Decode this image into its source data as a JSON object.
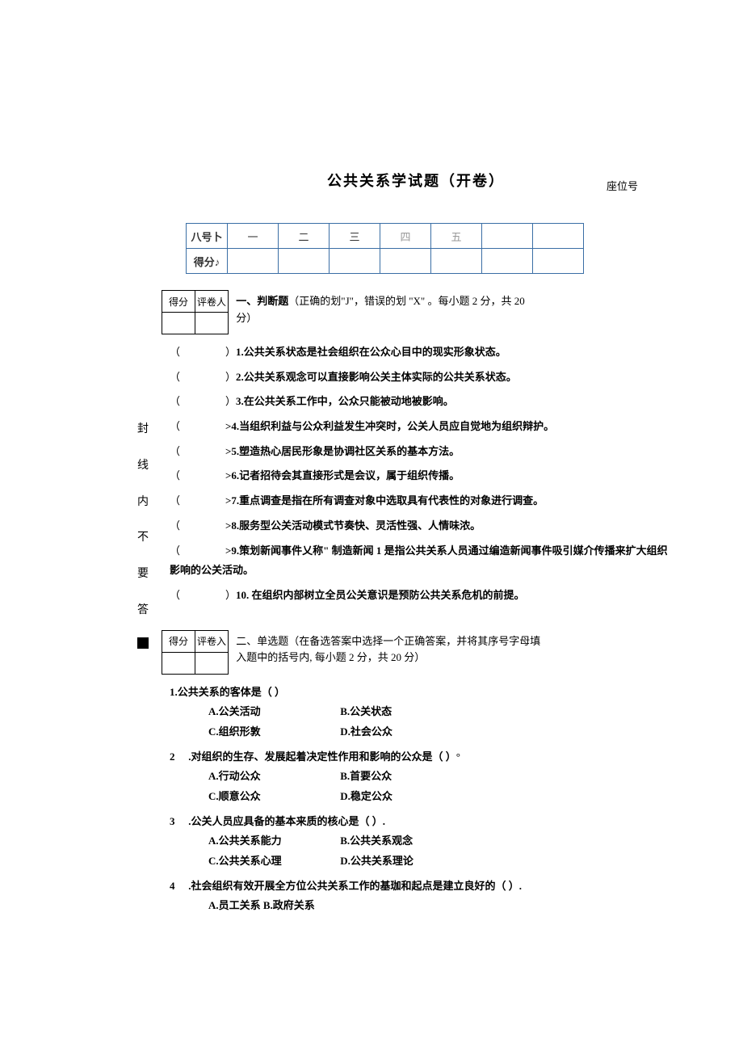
{
  "seat_label": "座位号",
  "title": "公共关系学试题（开卷）",
  "score_table": {
    "row1_head": "八号卜",
    "row2_head": "得分♪",
    "cols": [
      "一",
      "二",
      "三",
      "四",
      "五",
      "",
      ""
    ]
  },
  "grade_box": {
    "c1": "得分",
    "c2": "评卷人"
  },
  "grade_box2": {
    "c1": "得分",
    "c2": "评卷入"
  },
  "section1": {
    "heading": "一、判断题",
    "note": "（正确的划\"J\"，错误的划 \"X\" 。每小题 2 分，共 20 分）",
    "items": {
      "q1": "1.公共关系状态是社会组织在公众心目中的现实形象状态。",
      "q2": "2.公共关系观念可以直接影响公关主体实际的公共关系状态。",
      "q3": "3.在公共关系工作中，公众只能被动地被影响。",
      "q4": ">4.当组织利益与公众利益发生冲突时，公关人员应自觉地为组织辩护。",
      "q5": ">5.塑造热心居民形象是协调社区关系的基本方法。",
      "q6": ">6.记者招待会其直接形式是会议，属于组织传播。",
      "q7": ">7.重点调查是指在所有调查对象中选取具有代表性的对象进行调查。",
      "q8": ">8.服务型公关活动模式节奏快、灵活性强、人情味浓。",
      "q9": ">9.策划新闻事件乂称\" 制造新闻 1 是指公共关系人员通过编造新闻事件吸引媒介传播来扩大组织影响的公关活动。",
      "q10": "10. 在组织内部树立全员公关意识是预防公共关系危机的前提。"
    }
  },
  "side": {
    "s1": "封",
    "s2": "线",
    "s3": "内",
    "s4": "不",
    "s5": "要",
    "s6": "答"
  },
  "section2": {
    "heading": "二、单选题（在备选答案中选择一个正确答案，并将其序号字母填入题中的括号内, 每小题 2 分，共 20 分）",
    "q1": {
      "stem": "1.公共关系的客体是（        ）",
      "a": "A.公关活动",
      "b": "B.公关状态",
      "c": "C.组织形敦",
      "d": "D.社会公众"
    },
    "q2": {
      "num": "2",
      "stem": " .对组织的生存、发展起着决定性作用和影响的公众是（       ）°",
      "a": "A.行动公众",
      "b": "B.首要公众",
      "c": "C.顺意公众",
      "d": "D.稳定公众"
    },
    "q3": {
      "num": "3",
      "stem": " .公关人员应具备的基本来质的核心是（      ）.",
      "a": "A.公共关系能力",
      "b": "B.公共关系观念",
      "c": "C.公共关系心理",
      "d": "D.公共关系理论"
    },
    "q4": {
      "num": "4",
      "stem": " .社会组织有效开展全方位公共关系工作的基珈和起点是建立良好的（        ）.",
      "a": "A.员工关系 B.政府关系"
    }
  },
  "paren_open": "（",
  "paren_close": "）"
}
